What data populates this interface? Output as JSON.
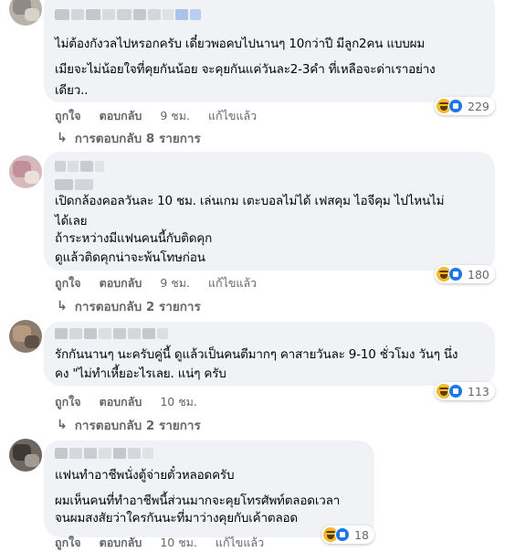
{
  "ui": {
    "like_label": "ถูกใจ",
    "reply_label": "ตอบกลับ",
    "edited_label": "แก้ไขแล้ว"
  },
  "comments": [
    {
      "lines": [
        "ไม่ต้องกังวลไปหรอกครับ เดี๋ยวพอคบไปนานๆ 10กว่าปี มีลูก2คน แบบผม",
        "เมียจะไม่น้อยใจที่คุยกันน้อย จะคุยกันแค่วันละ2-3คำ ที่เหลือจะด่าเราอย่าง",
        "เดียว.."
      ],
      "time": "9 ชม.",
      "reaction_count": "229",
      "replies": "การตอบกลับ 8 รายการ"
    },
    {
      "lines": [
        "เปิดกล้องคอลวันละ 10 ชม. เล่นเกม เตะบอลไม่ได้ เฟสคุม ไอจีคุม ไปไหนไม่",
        "ได้เลย",
        "ถ้าระหว่างมีแฟนคนนี้กับติดคุก",
        "ดูแล้วติดคุกน่าจะพ้นโทษก่อน"
      ],
      "time": "9 ชม.",
      "reaction_count": "180",
      "replies": "การตอบกลับ 2 รายการ"
    },
    {
      "lines": [
        "รักกันนานๆ นะครับคู่นี้ ดูแล้วเป็นคนตีมากๆ คาสายวันละ 9-10 ชั่วโมง วันๆ นึ่ง",
        "คง \"ไม่ทำเหี้ยอะไรเลย. แน่ๆ ครับ"
      ],
      "time": "10 ชม.",
      "reaction_count": "113",
      "replies": "การตอบกลับ 2 รายการ"
    },
    {
      "lines": [
        "แฟนทำอาชีพนั่งตู้จ่ายตั๋วหลอดครับ",
        "ผมเห็นคนที่ทำอาชีพนี้ส่วนมากจะคุยโทรศัพท์ตลอดเวลา",
        "จนผมสงสัยว่าใครกันนะที่มาว่างคุยกับเค้าตลอด"
      ],
      "time": "10 ชม.",
      "reaction_count": "18"
    }
  ],
  "icons": {
    "reaction_1": "haha-emoji-icon",
    "reaction_2": "like-emoji-icon",
    "reply_arrow": "reply-arrow-icon"
  },
  "colors": {
    "bubble_bg": "#f0f2f5",
    "meta_text": "#65676b",
    "like_blue": "#1877f2",
    "haha_yellow": "#f7b928"
  }
}
